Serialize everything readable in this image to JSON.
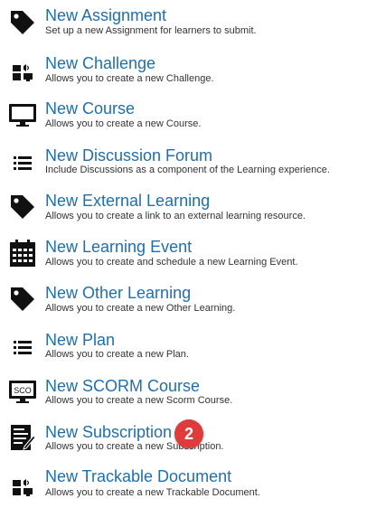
{
  "items": [
    {
      "icon": "tag-icon",
      "title": "New Assignment",
      "desc": "Set up a new Assignment for learners to submit."
    },
    {
      "icon": "challenge-icon",
      "title": "New Challenge",
      "desc": "Allows you to create a new Challenge."
    },
    {
      "icon": "monitor-icon",
      "title": "New Course",
      "desc": "Allows you to create a new Course."
    },
    {
      "icon": "list-icon",
      "title": "New Discussion Forum",
      "desc": "Include Discussions as a component of the Learning experience."
    },
    {
      "icon": "tag-icon",
      "title": "New External Learning",
      "desc": "Allows you to create a link to an external learning resource."
    },
    {
      "icon": "calendar-icon",
      "title": "New Learning Event",
      "desc": "Allows you to create and schedule a new Learning Event."
    },
    {
      "icon": "tag-icon",
      "title": "New Other Learning",
      "desc": "Allows you to create a new Other Learning."
    },
    {
      "icon": "list-icon",
      "title": "New Plan",
      "desc": "Allows you to create a new Plan."
    },
    {
      "icon": "scorm-monitor-icon",
      "title": "New SCORM Course",
      "desc": "Allows you to create a new Scorm Course.",
      "icon_text": "SCO"
    },
    {
      "icon": "subscription-icon",
      "title": "New Subscription",
      "desc": "Allows you to create a new Subscription."
    },
    {
      "icon": "challenge-icon",
      "title": "New Trackable Document",
      "desc": "Allows you to create a new Trackable Document."
    }
  ],
  "badge": {
    "label": "2",
    "color": "#e03b3b"
  },
  "colors": {
    "title": "#1f6fad",
    "desc": "#333333",
    "icon": "#111111"
  }
}
